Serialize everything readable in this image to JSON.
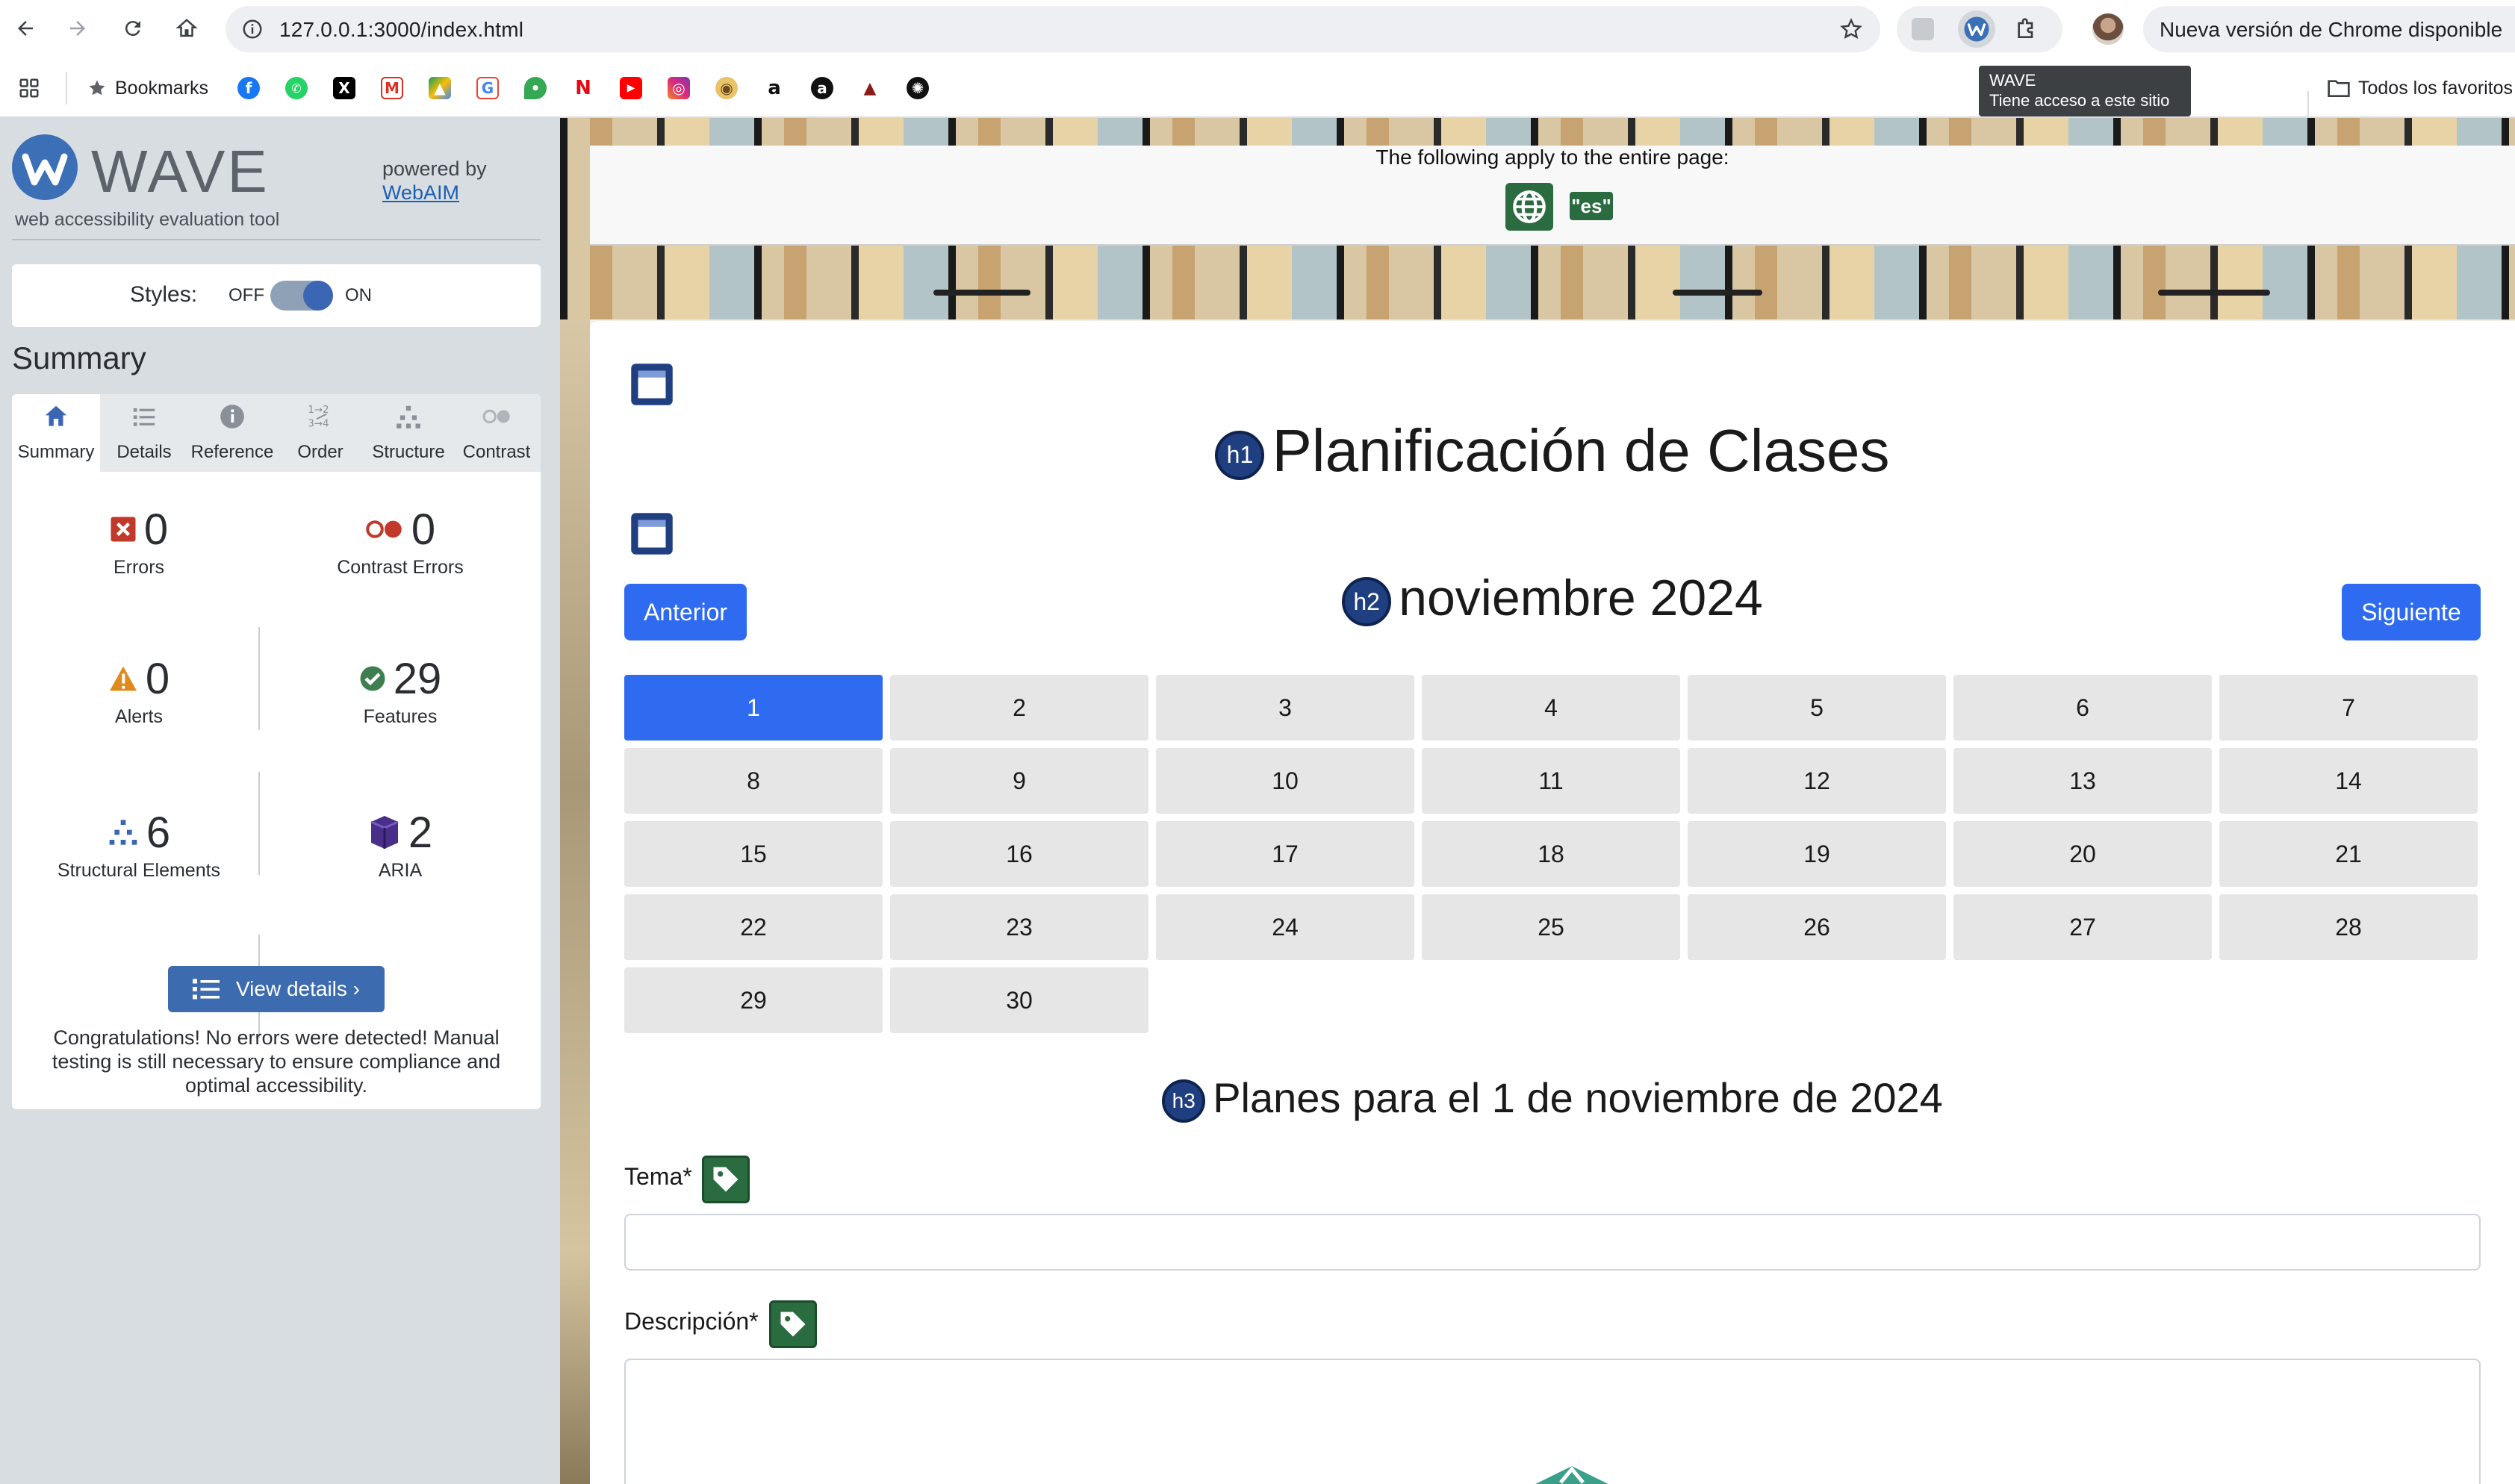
{
  "browser": {
    "url": "127.0.0.1:3000/index.html",
    "update_notice": "Nueva versión de Chrome disponible",
    "bookmarks_label": "Bookmarks",
    "all_bookmarks_label": "Todos los favoritos",
    "tooltip": {
      "title": "WAVE",
      "body": "Tiene acceso a este sitio"
    },
    "bookmark_icons": [
      "facebook-icon",
      "whatsapp-icon",
      "x-icon",
      "gmail-icon",
      "drive-icon",
      "google-icon",
      "maps-icon",
      "netflix-icon",
      "youtube-icon",
      "instagram-icon",
      "bookmark-icon-10",
      "amazon-icon",
      "bookmark-icon-12",
      "graduation-cap-icon",
      "chatgpt-icon"
    ]
  },
  "wave": {
    "title": "WAVE",
    "subtitle": "web accessibility evaluation tool",
    "powered_by": "powered by",
    "powered_link": "WebAIM",
    "styles_label": "Styles:",
    "toggle_off": "OFF",
    "toggle_on": "ON",
    "summary_heading": "Summary",
    "tabs": [
      {
        "label": "Summary",
        "icon": "home-icon"
      },
      {
        "label": "Details",
        "icon": "list-icon"
      },
      {
        "label": "Reference",
        "icon": "info-icon"
      },
      {
        "label": "Order",
        "icon": "order-icon"
      },
      {
        "label": "Structure",
        "icon": "structure-icon"
      },
      {
        "label": "Contrast",
        "icon": "contrast-icon"
      }
    ],
    "stats": {
      "errors": {
        "value": "0",
        "label": "Errors"
      },
      "contrast_errors": {
        "value": "0",
        "label": "Contrast Errors"
      },
      "alerts": {
        "value": "0",
        "label": "Alerts"
      },
      "features": {
        "value": "29",
        "label": "Features"
      },
      "structural": {
        "value": "6",
        "label": "Structural Elements"
      },
      "aria": {
        "value": "2",
        "label": "ARIA"
      }
    },
    "view_details": "View details ›",
    "congrats": "Congratulations! No errors were detected! Manual testing is still necessary to ensure compliance and optimal accessibility."
  },
  "page": {
    "apply_note": "The following apply to the entire page:",
    "lang_badge": "\"es\"",
    "h1": "Planificación de Clases",
    "h1_badge": "h1",
    "h2": "noviembre 2024",
    "h2_badge": "h2",
    "prev_button": "Anterior",
    "next_button": "Siguiente",
    "selected_day": "1",
    "days": [
      "1",
      "2",
      "3",
      "4",
      "5",
      "6",
      "7",
      "8",
      "9",
      "10",
      "11",
      "12",
      "13",
      "14",
      "15",
      "16",
      "17",
      "18",
      "19",
      "20",
      "21",
      "22",
      "23",
      "24",
      "25",
      "26",
      "27",
      "28",
      "29",
      "30"
    ],
    "h3": "Planes para el 1 de noviembre de 2024",
    "h3_badge": "h3",
    "tema_label": "Tema*",
    "descripcion_label": "Descripción*"
  },
  "colors": {
    "wave_blue": "#3b6fb6",
    "primary_button": "#2e6bf0",
    "wave_feature_green": "#2b6b40",
    "heading_badge": "#1f3f80"
  }
}
